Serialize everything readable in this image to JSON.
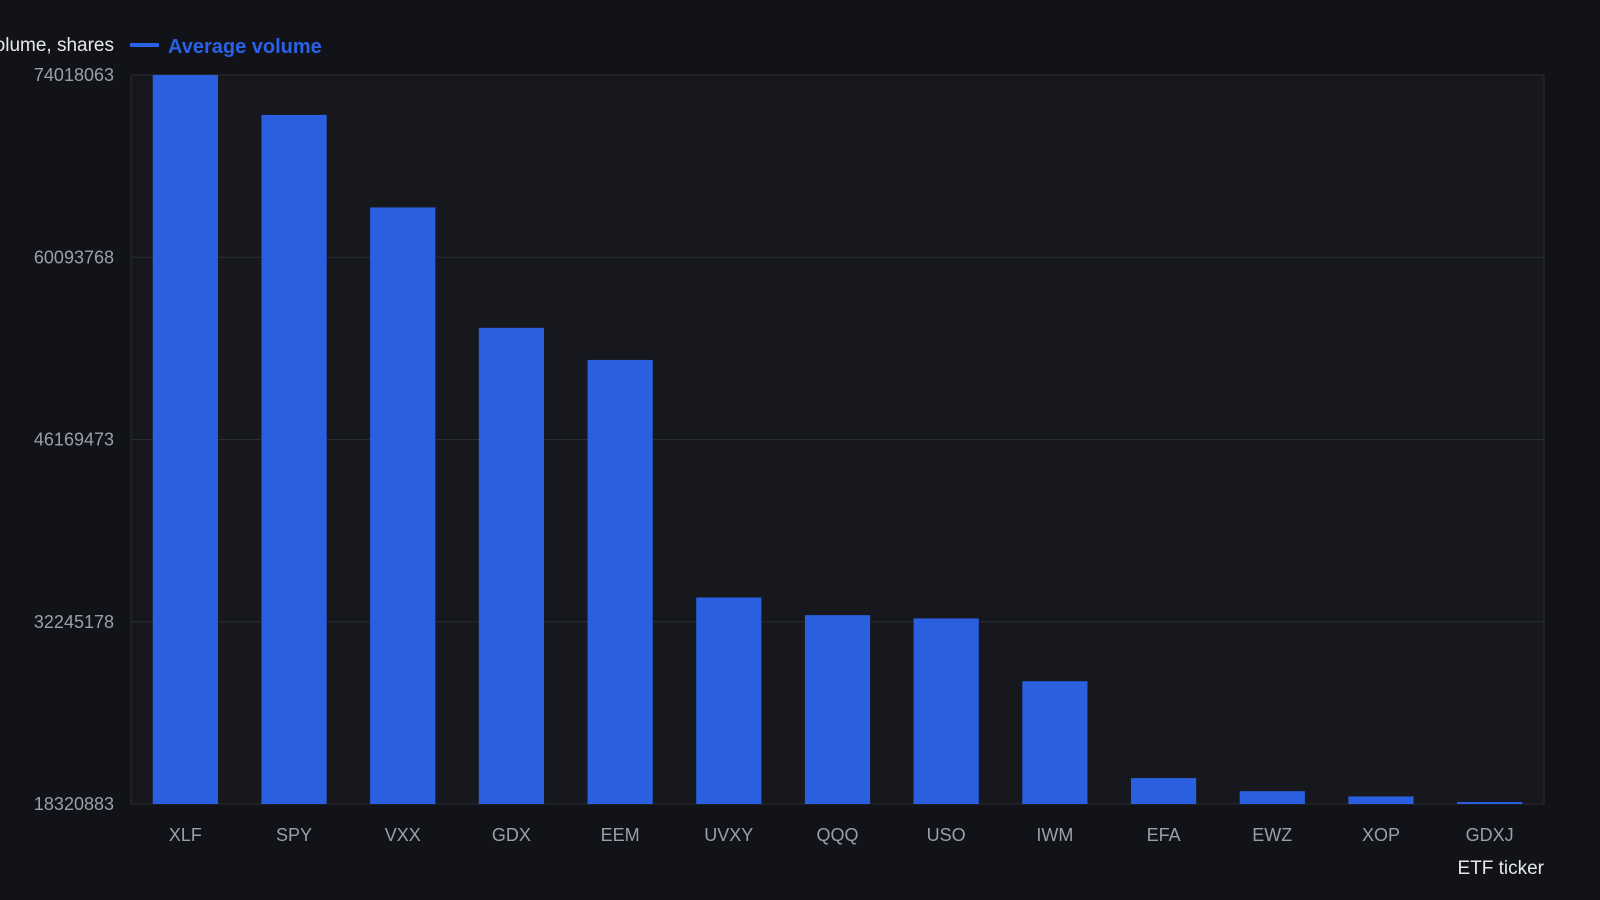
{
  "chart_data": {
    "type": "bar",
    "title": "",
    "xlabel": "ETF ticker",
    "ylabel": "Average volume, shares",
    "categories": [
      "XLF",
      "SPY",
      "VXX",
      "GDX",
      "EEM",
      "UVXY",
      "QQQ",
      "USO",
      "IWM",
      "EFA",
      "EWZ",
      "XOP",
      "GDXJ"
    ],
    "series": [
      {
        "name": "Average volume",
        "values": [
          74018063,
          70970000,
          63900000,
          54700000,
          52250000,
          34100000,
          32750000,
          32500000,
          27700000,
          20300000,
          19300000,
          18900000,
          18200000
        ]
      }
    ],
    "ylim": [
      18320883,
      74018063
    ],
    "yticks": [
      "74018063",
      "60093768",
      "46169473",
      "32245178",
      "18320883"
    ],
    "grid": true,
    "legend_position": "top-left",
    "colors": {
      "background": "#111318",
      "plot_background": "#16181d",
      "bar": "#2a5fe0",
      "grid": "#2a2d34",
      "tick_text": "#9aa0a8",
      "axis_title_text": "#e6e8eb",
      "legend_text": "#2a62e6"
    }
  }
}
